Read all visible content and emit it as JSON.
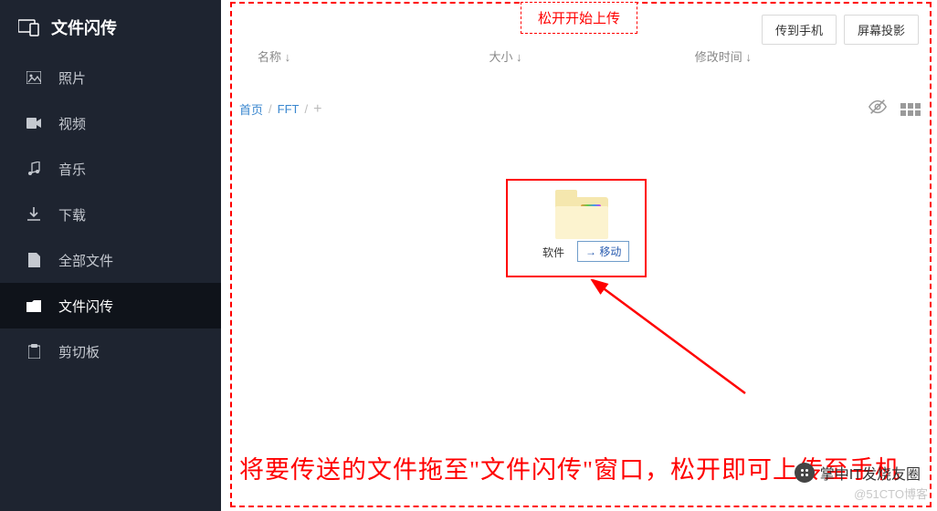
{
  "app": {
    "title": "文件闪传"
  },
  "sidebar": {
    "items": [
      {
        "label": "照片"
      },
      {
        "label": "视频"
      },
      {
        "label": "音乐"
      },
      {
        "label": "下载"
      },
      {
        "label": "全部文件"
      },
      {
        "label": "文件闪传"
      },
      {
        "label": "剪切板"
      }
    ]
  },
  "drop": {
    "banner": "松开开始上传"
  },
  "toolbar": {
    "send_to_phone": "传到手机",
    "screen_mirror": "屏幕投影"
  },
  "columns": {
    "name": "名称 ↓",
    "size": "大小 ↓",
    "modified": "修改时间 ↓"
  },
  "breadcrumb": {
    "root": "首页",
    "sep": "/",
    "current": "FFT",
    "plus": "+"
  },
  "drag": {
    "folder_label": "软件",
    "move_tip": "→ 移动"
  },
  "instruction": "将要传送的文件拖至\"文件闪传\"窗口，松开即可上传至手机",
  "watermark": {
    "brand": "掌中IT发烧友圈",
    "sub": "@51CTO博客"
  }
}
